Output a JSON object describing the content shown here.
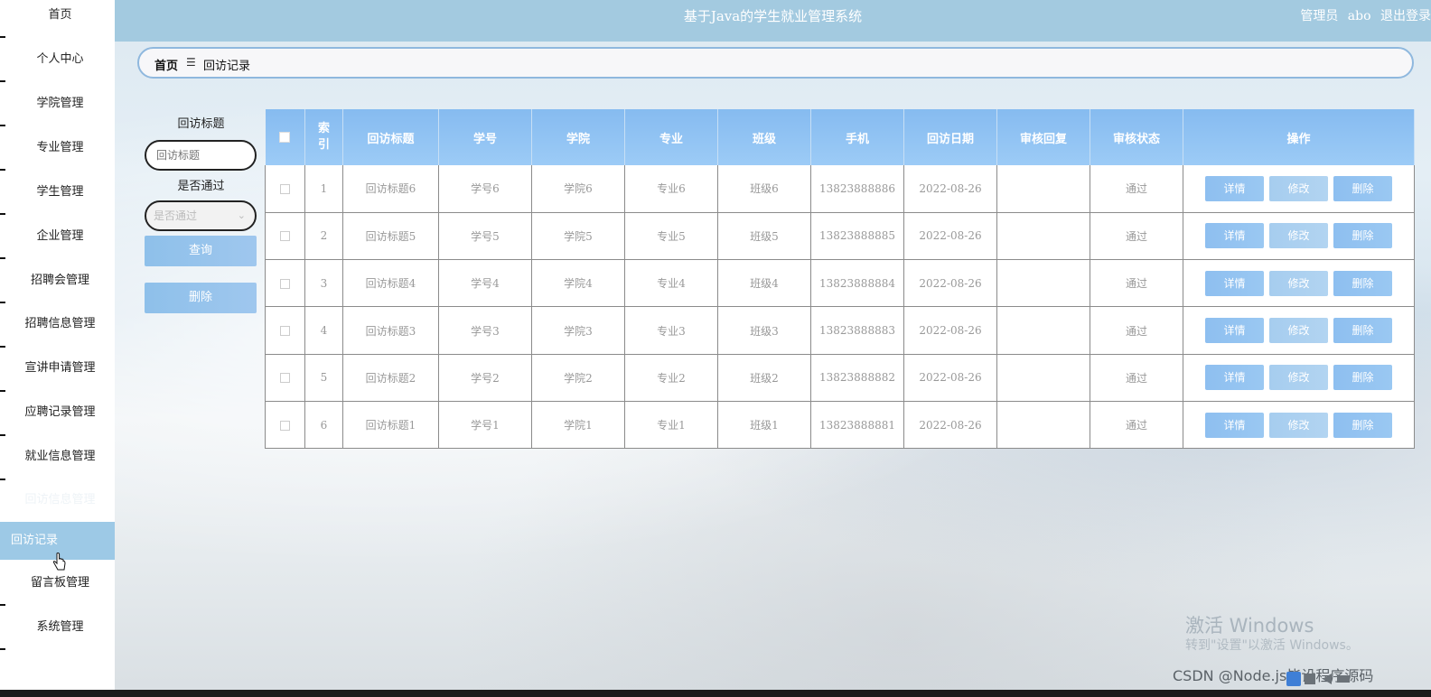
{
  "app_title": "基于Java的学生就业管理系统",
  "user": {
    "role": "管理员",
    "name": "abo",
    "logout": "退出登录"
  },
  "breadcrumb": {
    "home": "首页",
    "separator": "☰",
    "current": "回访记录"
  },
  "sidebar": {
    "items": [
      {
        "label": "首页"
      },
      {
        "label": "个人中心"
      },
      {
        "label": "学院管理"
      },
      {
        "label": "专业管理"
      },
      {
        "label": "学生管理"
      },
      {
        "label": "企业管理"
      },
      {
        "label": "招聘会管理"
      },
      {
        "label": "招聘信息管理"
      },
      {
        "label": "宣讲申请管理"
      },
      {
        "label": "应聘记录管理"
      },
      {
        "label": "就业信息管理"
      },
      {
        "label": "回访信息管理"
      },
      {
        "label": "回访记录"
      },
      {
        "label": "留言板管理"
      },
      {
        "label": "系统管理"
      }
    ],
    "active_index": 12
  },
  "search": {
    "title_label": "回访标题",
    "title_placeholder": "回访标题",
    "pass_label": "是否通过",
    "pass_placeholder": "是否通过",
    "query_button": "查询",
    "delete_button": "删除"
  },
  "table": {
    "headers": [
      "",
      "索引",
      "回访标题",
      "学号",
      "学院",
      "专业",
      "班级",
      "手机",
      "回访日期",
      "审核回复",
      "审核状态",
      "操作"
    ],
    "rows": [
      {
        "index": "1",
        "title": "回访标题6",
        "student_no": "学号6",
        "college": "学院6",
        "major": "专业6",
        "class": "班级6",
        "phone": "13823888886",
        "date": "2022-08-26",
        "reply": "",
        "status": "通过"
      },
      {
        "index": "2",
        "title": "回访标题5",
        "student_no": "学号5",
        "college": "学院5",
        "major": "专业5",
        "class": "班级5",
        "phone": "13823888885",
        "date": "2022-08-26",
        "reply": "",
        "status": "通过"
      },
      {
        "index": "3",
        "title": "回访标题4",
        "student_no": "学号4",
        "college": "学院4",
        "major": "专业4",
        "class": "班级4",
        "phone": "13823888884",
        "date": "2022-08-26",
        "reply": "",
        "status": "通过"
      },
      {
        "index": "4",
        "title": "回访标题3",
        "student_no": "学号3",
        "college": "学院3",
        "major": "专业3",
        "class": "班级3",
        "phone": "13823888883",
        "date": "2022-08-26",
        "reply": "",
        "status": "通过"
      },
      {
        "index": "5",
        "title": "回访标题2",
        "student_no": "学号2",
        "college": "学院2",
        "major": "专业2",
        "class": "班级2",
        "phone": "13823888882",
        "date": "2022-08-26",
        "reply": "",
        "status": "通过"
      },
      {
        "index": "6",
        "title": "回访标题1",
        "student_no": "学号1",
        "college": "学院1",
        "major": "专业1",
        "class": "班级1",
        "phone": "13823888881",
        "date": "2022-08-26",
        "reply": "",
        "status": "通过"
      }
    ],
    "actions": {
      "detail": "详情",
      "edit": "修改",
      "delete": "删除"
    }
  },
  "watermark": {
    "line1": "激活 Windows",
    "line2": "转到\"设置\"以激活 Windows。"
  },
  "csdn_credit": "CSDN @Node.js毕设程序源码",
  "colors": {
    "topbar": "#a3cae0",
    "table_header": "#86bbf0",
    "button": "#8ec0ea",
    "active_sidebar": "#9dc9e6"
  }
}
